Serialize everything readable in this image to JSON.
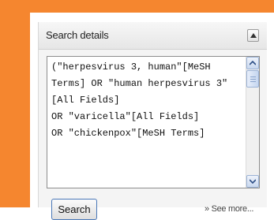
{
  "panel": {
    "title": "Search details",
    "collapse_icon": "triangle-up-icon",
    "query": "(\"herpesvirus 3, human\"[MeSH Terms] OR \"human herpesvirus 3\"[All Fields]\nOR \"varicella\"[All Fields]\nOR \"chickenpox\"[MeSH Terms]",
    "search_button_label": "Search",
    "see_more_label": "» See more..."
  },
  "colors": {
    "border_orange": "#f5862f",
    "panel_bg": "#f4f4f4",
    "button_border": "#4a78b8"
  }
}
